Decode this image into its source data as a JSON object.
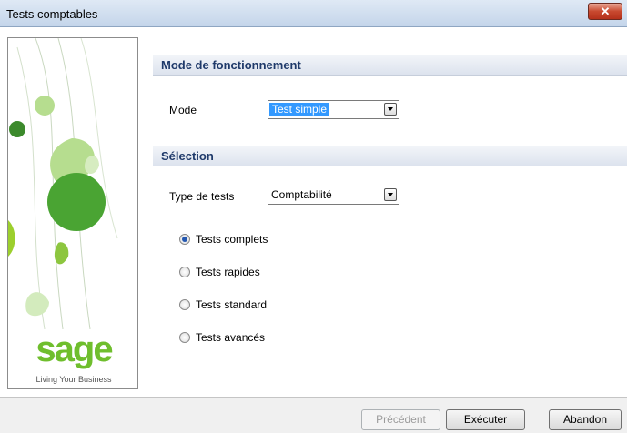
{
  "window": {
    "title": "Tests comptables",
    "close_symbol": "✕"
  },
  "sidebar": {
    "logo_text": "sage",
    "tagline": "Living Your Business",
    "colors": {
      "accent": "#6fbe2d",
      "light": "#b6dd8f"
    }
  },
  "sections": {
    "mode_header": "Mode de fonctionnement",
    "selection_header": "Sélection"
  },
  "mode": {
    "label": "Mode",
    "value": "Test simple"
  },
  "selection": {
    "type_label": "Type de tests",
    "type_value": "Comptabilité",
    "options": [
      {
        "label": "Tests complets",
        "selected": true
      },
      {
        "label": "Tests rapides",
        "selected": false
      },
      {
        "label": "Tests standard",
        "selected": false
      },
      {
        "label": "Tests avancés",
        "selected": false
      }
    ]
  },
  "footer": {
    "previous_label": "Précédent",
    "execute_label": "Exécuter",
    "abort_label": "Abandon"
  }
}
